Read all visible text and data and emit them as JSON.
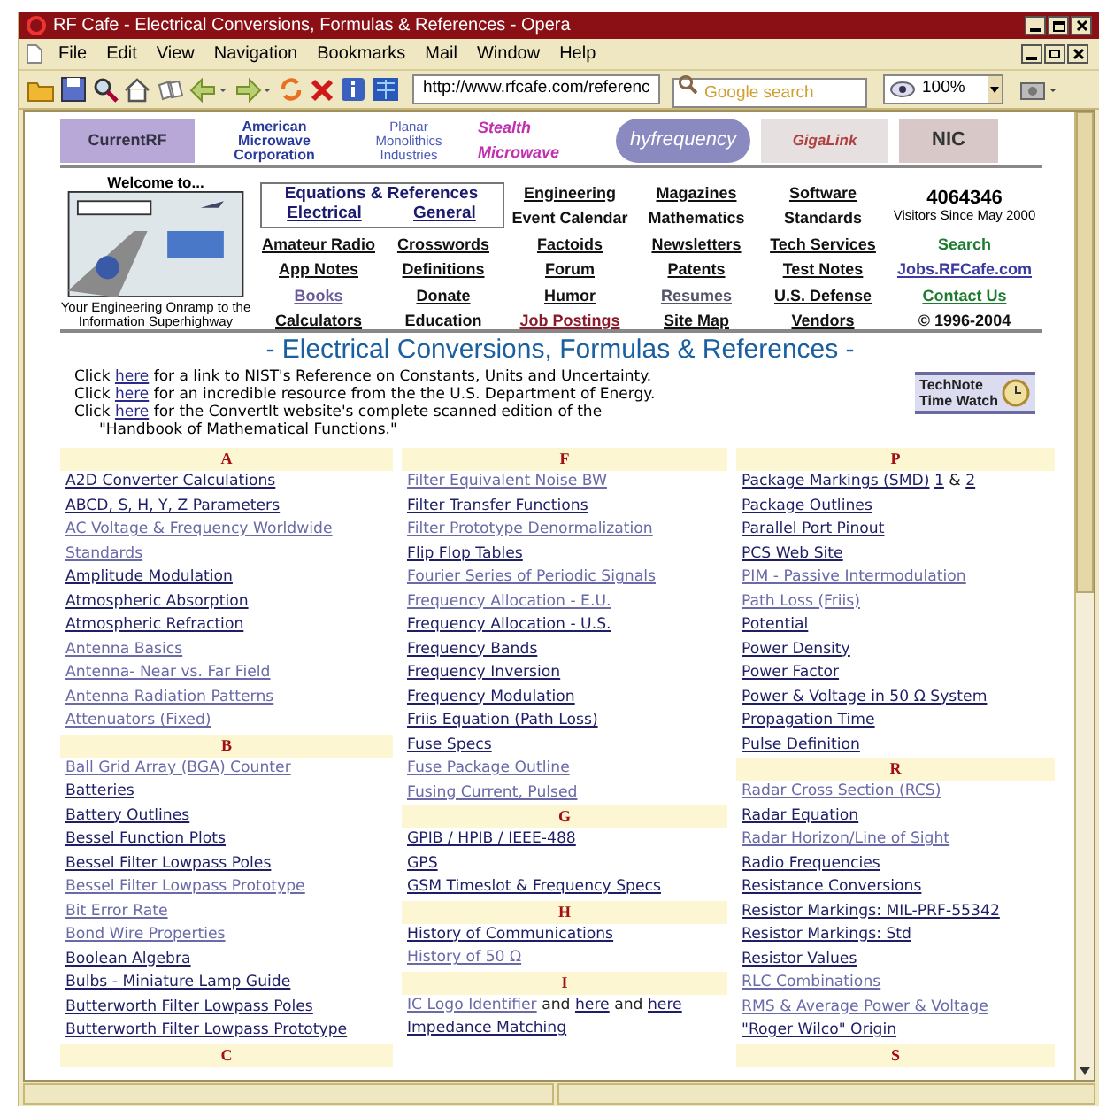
{
  "window": {
    "title": "RF Cafe - Electrical Conversions, Formulas & References - Opera"
  },
  "menu": [
    "File",
    "Edit",
    "View",
    "Navigation",
    "Bookmarks",
    "Mail",
    "Window",
    "Help"
  ],
  "toolbar": {
    "address": "http://www.rfcafe.com/referenc",
    "search_placeholder": "Google search",
    "zoom": "100%"
  },
  "sponsors": [
    "CurrentRF",
    "American Microwave Corporation",
    "Planar Monolithics Industries",
    "Stealth Microwave",
    "hyfrequency",
    "GigaLink",
    "NIC"
  ],
  "welcome": {
    "heading": "Welcome to...",
    "caption": "Your Engineering Onramp to the Information Superhighway"
  },
  "nav": {
    "equations_box": {
      "title": "Equations & References",
      "links": [
        "Electrical",
        "General"
      ]
    },
    "counter": {
      "value": "4064346",
      "caption": "Visitors Since May 2000"
    },
    "rows": [
      [
        {
          "text": "Engineering",
          "underlined": true
        },
        {
          "text": "Magazines",
          "underlined": true
        },
        {
          "text": "Software",
          "underlined": true
        }
      ],
      [
        {
          "text": "Event Calendar",
          "underlined": false
        },
        {
          "text": "Mathematics",
          "underlined": false
        },
        {
          "text": "Standards",
          "underlined": false
        }
      ],
      [
        {
          "text": "Amateur Radio",
          "underlined": true
        },
        {
          "text": "Crosswords",
          "underlined": true
        },
        {
          "text": "Factoids",
          "underlined": true
        },
        {
          "text": "Newsletters",
          "underlined": true
        },
        {
          "text": "Tech Services",
          "underlined": true
        },
        {
          "text": "Search",
          "underlined": false,
          "color": "#1e7a2e"
        }
      ],
      [
        {
          "text": "App Notes",
          "underlined": true
        },
        {
          "text": "Definitions",
          "underlined": true
        },
        {
          "text": "Forum",
          "underlined": true
        },
        {
          "text": "Patents",
          "underlined": true
        },
        {
          "text": "Test Notes",
          "underlined": true
        },
        {
          "text": "Jobs.RFCafe.com",
          "underlined": true,
          "color": "#3a3aa0"
        }
      ],
      [
        {
          "text": "Books",
          "underlined": true,
          "color": "#6a5a9a"
        },
        {
          "text": "Donate",
          "underlined": true
        },
        {
          "text": "Humor",
          "underlined": true
        },
        {
          "text": "Resumes",
          "underlined": true,
          "color": "#55556a"
        },
        {
          "text": "U.S. Defense",
          "underlined": true
        },
        {
          "text": "Contact Us",
          "underlined": true,
          "color": "#1e7a2e"
        }
      ],
      [
        {
          "text": "Calculators",
          "underlined": true
        },
        {
          "text": "Education",
          "underlined": false
        },
        {
          "text": "Job Postings",
          "underlined": true,
          "color": "#8a1a2a"
        },
        {
          "text": "Site Map",
          "underlined": true
        },
        {
          "text": "Vendors",
          "underlined": true
        },
        {
          "text": "© 1996-2004",
          "underlined": false
        }
      ]
    ]
  },
  "page_title": "- Electrical Conversions, Formulas & References -",
  "intro": [
    {
      "prefix": "Click",
      "link": "here",
      "text": "for a link to NIST's Reference on Constants, Units and Uncertainty."
    },
    {
      "prefix": "Click",
      "link": "here",
      "text": "for an incredible resource from the the U.S. Department of Energy."
    },
    {
      "prefix": "Click",
      "link": "here",
      "text": "for the ConvertIt website's complete scanned edition of the"
    }
  ],
  "intro_continuation": "\"Handbook of Mathematical Functions.\"",
  "badge": {
    "line1": "TechNote",
    "line2": "Time Watch"
  },
  "columns": [
    {
      "sections": [
        {
          "letter": "A",
          "items": [
            {
              "text": "A2D Converter Calculations",
              "visited": false
            },
            {
              "text": "ABCD, S, H, Y, Z Parameters",
              "visited": false
            },
            {
              "text": "AC Voltage & Frequency Worldwide Standards",
              "visited": true
            },
            {
              "text": "Amplitude Modulation",
              "visited": false
            },
            {
              "text": "Atmospheric Absorption",
              "visited": false
            },
            {
              "text": "Atmospheric Refraction",
              "visited": false
            },
            {
              "text": "Antenna Basics",
              "visited": true
            },
            {
              "text": "Antenna- Near vs. Far Field",
              "visited": true
            },
            {
              "text": "Antenna Radiation Patterns",
              "visited": true
            },
            {
              "text": "Attenuators (Fixed)",
              "visited": true
            }
          ]
        },
        {
          "letter": "B",
          "items": [
            {
              "text": "Ball Grid Array (BGA) Counter",
              "visited": true
            },
            {
              "text": "Batteries",
              "visited": false
            },
            {
              "text": "Battery Outlines",
              "visited": false
            },
            {
              "text": "Bessel Function Plots",
              "visited": false
            },
            {
              "text": "Bessel Filter Lowpass Poles",
              "visited": false
            },
            {
              "text": "Bessel Filter Lowpass Prototype",
              "visited": true
            },
            {
              "text": "Bit Error Rate",
              "visited": true
            },
            {
              "text": "Bond Wire Properties",
              "visited": true
            },
            {
              "text": "Boolean Algebra",
              "visited": false
            },
            {
              "text": "Bulbs - Miniature Lamp Guide",
              "visited": false
            },
            {
              "text": "Butterworth Filter Lowpass Poles",
              "visited": false
            },
            {
              "text": "Butterworth Filter Lowpass Prototype",
              "visited": false
            }
          ]
        },
        {
          "letter": "C"
        }
      ]
    },
    {
      "sections": [
        {
          "letter": "F",
          "items": [
            {
              "text": "Filter Equivalent Noise BW",
              "visited": true
            },
            {
              "text": "Filter Transfer Functions",
              "visited": false
            },
            {
              "text": "Filter Prototype Denormalization",
              "visited": true
            },
            {
              "text": "Flip Flop Tables",
              "visited": false
            },
            {
              "text": "Fourier Series of Periodic Signals",
              "visited": true
            },
            {
              "text": "Frequency Allocation - E.U.",
              "visited": true
            },
            {
              "text": "Frequency Allocation - U.S.",
              "visited": false
            },
            {
              "text": "Frequency Bands",
              "visited": false
            },
            {
              "text": "Frequency Inversion",
              "visited": false
            },
            {
              "text": "Frequency Modulation",
              "visited": false
            },
            {
              "text": "Friis Equation (Path Loss)",
              "visited": false
            },
            {
              "text": "Fuse Specs",
              "visited": false
            },
            {
              "text": "Fuse Package Outline",
              "visited": true
            },
            {
              "text": "Fusing Current, Pulsed",
              "visited": true
            }
          ]
        },
        {
          "letter": "G",
          "items": [
            {
              "text": "GPIB / HPIB / IEEE-488",
              "visited": false
            },
            {
              "text": "GPS",
              "visited": false
            },
            {
              "text": "GSM Timeslot & Frequency Specs",
              "visited": false
            }
          ]
        },
        {
          "letter": "H",
          "items": [
            {
              "text": "History of Communications",
              "visited": false
            },
            {
              "text": "History of 50 Ω",
              "visited": true
            }
          ]
        },
        {
          "letter": "I",
          "items": [
            {
              "text": "IC Logo Identifier",
              "visited": true,
              "more": [
                {
                  "text": "and",
                  "link": false
                },
                {
                  "text": "here",
                  "link": true
                },
                {
                  "text": "and",
                  "link": false
                },
                {
                  "text": "here",
                  "link": true
                }
              ]
            },
            {
              "text": "Impedance Matching",
              "visited": false
            }
          ]
        }
      ]
    },
    {
      "sections": [
        {
          "letter": "P",
          "items": [
            {
              "text": "Package Markings (SMD)",
              "visited": false,
              "more": [
                {
                  "text": "1",
                  "link": true
                },
                {
                  "text": "&",
                  "link": false
                },
                {
                  "text": "2",
                  "link": true
                }
              ]
            },
            {
              "text": "Package Outlines",
              "visited": false
            },
            {
              "text": "Parallel Port Pinout",
              "visited": false
            },
            {
              "text": "PCS Web Site",
              "visited": false
            },
            {
              "text": "PIM - Passive Intermodulation",
              "visited": true
            },
            {
              "text": "Path Loss (Friis)",
              "visited": true
            },
            {
              "text": "Potential",
              "visited": false
            },
            {
              "text": "Power Density",
              "visited": false
            },
            {
              "text": "Power Factor",
              "visited": false
            },
            {
              "text": "Power & Voltage in 50 Ω System",
              "visited": false
            },
            {
              "text": "Propagation Time",
              "visited": false
            },
            {
              "text": "Pulse Definition",
              "visited": false
            }
          ]
        },
        {
          "letter": "R",
          "items": [
            {
              "text": "Radar Cross Section (RCS)",
              "visited": true
            },
            {
              "text": "Radar Equation",
              "visited": false
            },
            {
              "text": "Radar Horizon/Line of Sight",
              "visited": true
            },
            {
              "text": "Radio Frequencies",
              "visited": false
            },
            {
              "text": "Resistance Conversions",
              "visited": false
            },
            {
              "text": "Resistor Markings: MIL-PRF-55342",
              "visited": false
            },
            {
              "text": "Resistor Markings: Std",
              "visited": false
            },
            {
              "text": "Resistor Values",
              "visited": false
            },
            {
              "text": "RLC Combinations",
              "visited": true
            },
            {
              "text": "RMS & Average Power & Voltage",
              "visited": true
            },
            {
              "text": "\"Roger Wilco\" Origin",
              "visited": false
            }
          ]
        },
        {
          "letter": "S"
        }
      ]
    }
  ]
}
